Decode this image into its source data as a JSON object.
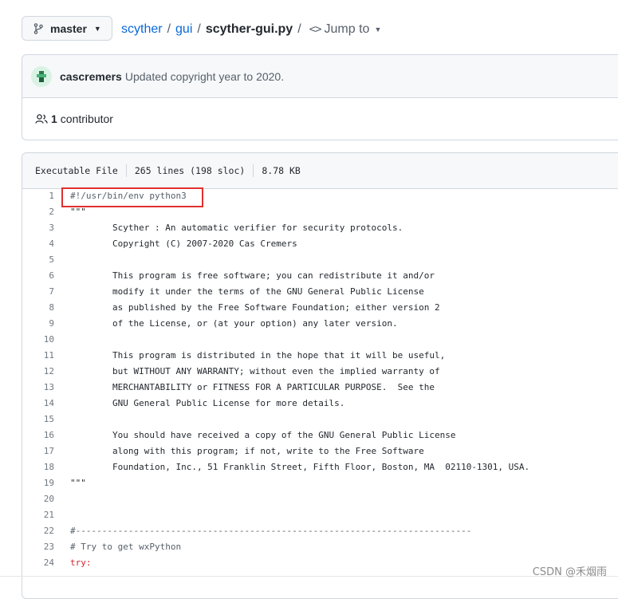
{
  "branch": {
    "label": "master",
    "icon": "git-branch-icon"
  },
  "breadcrumb": {
    "repo": "scyther",
    "folder": "gui",
    "file": "scyther-gui.py",
    "separator": "/",
    "jump_to": "Jump to"
  },
  "commit": {
    "author": "cascremers",
    "message": "Updated copyright year to 2020."
  },
  "contributors": {
    "count": "1",
    "label": "contributor"
  },
  "file_info": {
    "type": "Executable File",
    "lines": "265 lines (198 sloc)",
    "size": "8.78 KB"
  },
  "code_lines": [
    {
      "n": "1",
      "text": "#!/usr/bin/env python3",
      "style": "comment"
    },
    {
      "n": "2",
      "text": "\"\"\"",
      "style": "plain"
    },
    {
      "n": "3",
      "text": "        Scyther : An automatic verifier for security protocols.",
      "style": "plain"
    },
    {
      "n": "4",
      "text": "        Copyright (C) 2007-2020 Cas Cremers",
      "style": "plain"
    },
    {
      "n": "5",
      "text": "",
      "style": "plain"
    },
    {
      "n": "6",
      "text": "        This program is free software; you can redistribute it and/or",
      "style": "plain"
    },
    {
      "n": "7",
      "text": "        modify it under the terms of the GNU General Public License",
      "style": "plain"
    },
    {
      "n": "8",
      "text": "        as published by the Free Software Foundation; either version 2",
      "style": "plain"
    },
    {
      "n": "9",
      "text": "        of the License, or (at your option) any later version.",
      "style": "plain"
    },
    {
      "n": "10",
      "text": "",
      "style": "plain"
    },
    {
      "n": "11",
      "text": "        This program is distributed in the hope that it will be useful,",
      "style": "plain"
    },
    {
      "n": "12",
      "text": "        but WITHOUT ANY WARRANTY; without even the implied warranty of",
      "style": "plain"
    },
    {
      "n": "13",
      "text": "        MERCHANTABILITY or FITNESS FOR A PARTICULAR PURPOSE.  See the",
      "style": "plain"
    },
    {
      "n": "14",
      "text": "        GNU General Public License for more details.",
      "style": "plain"
    },
    {
      "n": "15",
      "text": "",
      "style": "plain"
    },
    {
      "n": "16",
      "text": "        You should have received a copy of the GNU General Public License",
      "style": "plain"
    },
    {
      "n": "17",
      "text": "        along with this program; if not, write to the Free Software",
      "style": "plain"
    },
    {
      "n": "18",
      "text": "        Foundation, Inc., 51 Franklin Street, Fifth Floor, Boston, MA  02110-1301, USA.",
      "style": "plain"
    },
    {
      "n": "19",
      "text": "\"\"\"",
      "style": "plain"
    },
    {
      "n": "20",
      "text": "",
      "style": "plain"
    },
    {
      "n": "21",
      "text": "",
      "style": "plain"
    },
    {
      "n": "22",
      "text": "#---------------------------------------------------------------------------",
      "style": "comment"
    },
    {
      "n": "23",
      "text": "# Try to get wxPython",
      "style": "comment"
    },
    {
      "n": "24",
      "text": "try:",
      "style": "kw"
    }
  ],
  "watermark": "CSDN @禾烟雨",
  "colors": {
    "link": "#0969da",
    "keyword": "#cf222e",
    "highlight_box": "#e0302f"
  }
}
